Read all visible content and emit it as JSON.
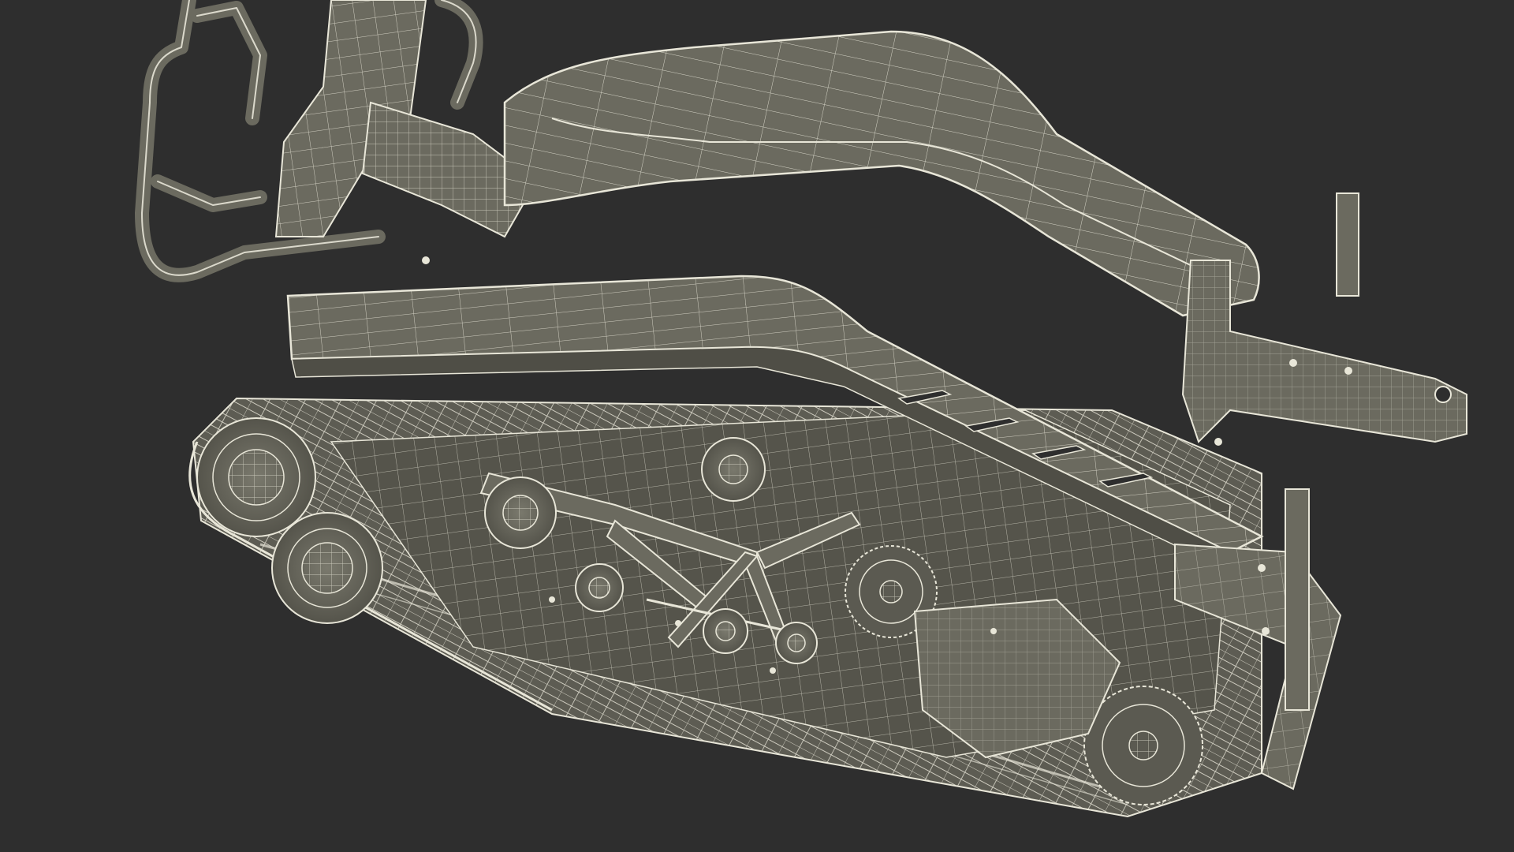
{
  "scene": {
    "background_color": "#2e2e2e",
    "mesh_fill_color": "#6b6a5f",
    "mesh_fill_dark_color": "#4f4e46",
    "wire_color": "#e8e6d8"
  }
}
